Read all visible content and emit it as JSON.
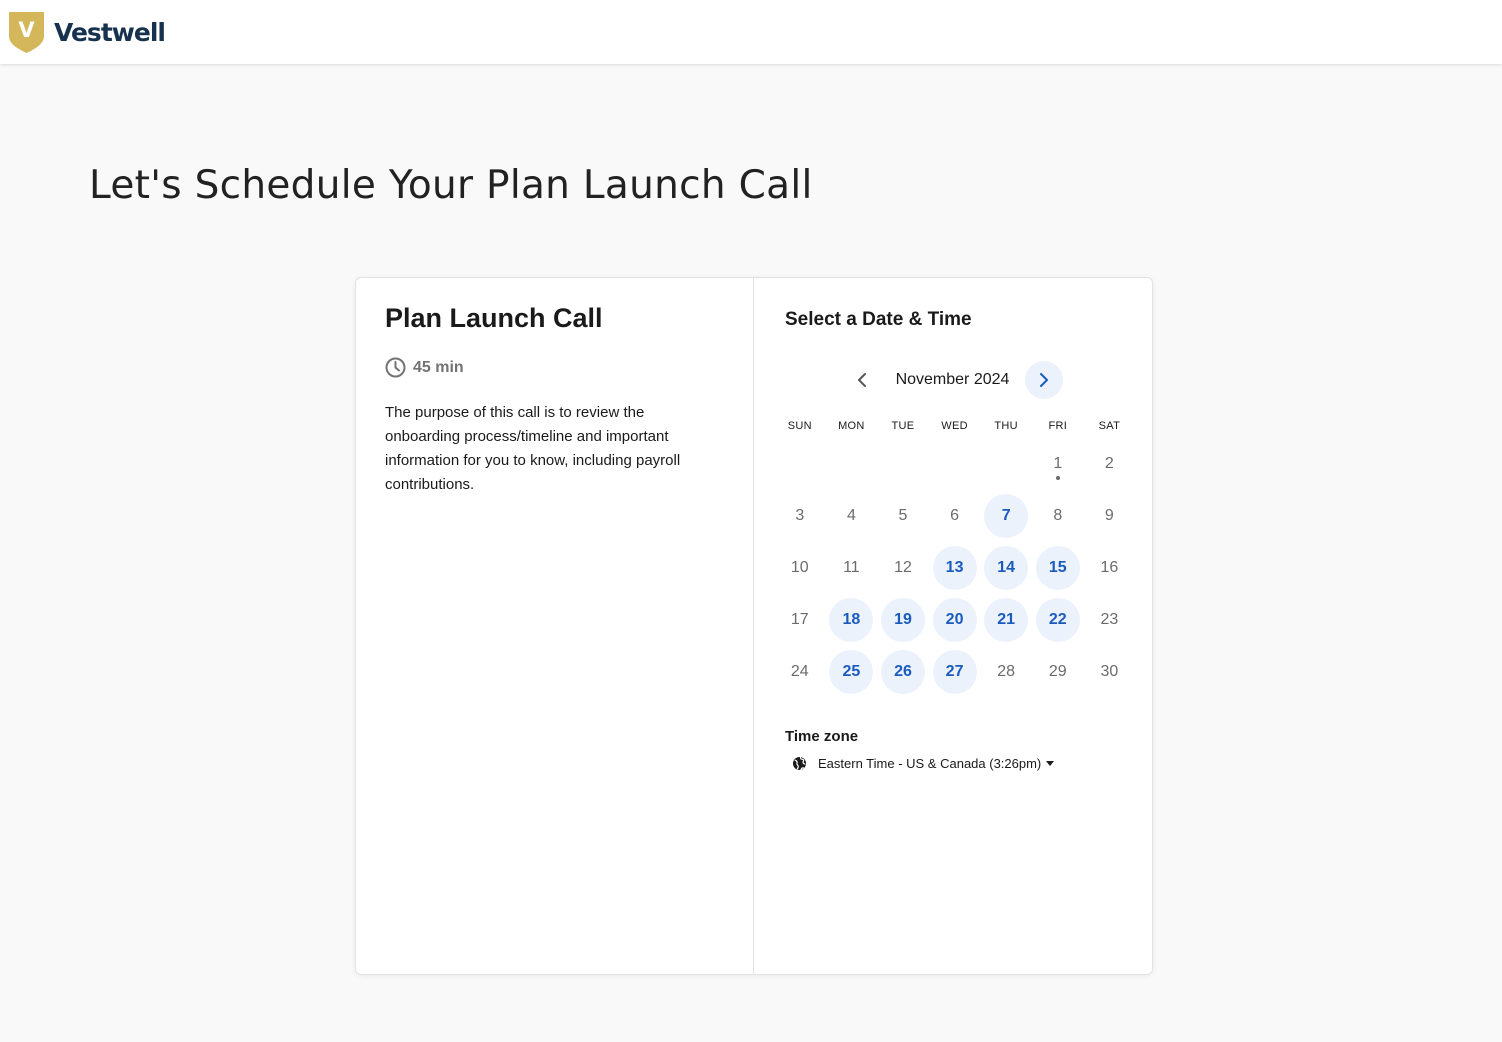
{
  "header": {
    "logo_letter": "V",
    "logo_text": "Vestwell",
    "logo_color": "#d4b75a",
    "brand_color": "#16324f"
  },
  "page": {
    "title": "Let's Schedule Your Plan Launch Call"
  },
  "event": {
    "title": "Plan Launch Call",
    "duration": "45 min",
    "description": "The purpose of this call is to review the onboarding process/timeline and important information for you to know, including payroll contributions."
  },
  "scheduler": {
    "title": "Select a Date & Time",
    "month": "November 2024",
    "prev_icon": "chevron-left-icon",
    "next_icon": "chevron-right-icon",
    "weekdays": [
      "SUN",
      "MON",
      "TUE",
      "WED",
      "THU",
      "FRI",
      "SAT"
    ],
    "days": [
      {
        "label": "",
        "available": false
      },
      {
        "label": "",
        "available": false
      },
      {
        "label": "",
        "available": false
      },
      {
        "label": "",
        "available": false
      },
      {
        "label": "",
        "available": false
      },
      {
        "label": "1",
        "available": false,
        "today": true
      },
      {
        "label": "2",
        "available": false
      },
      {
        "label": "3",
        "available": false
      },
      {
        "label": "4",
        "available": false
      },
      {
        "label": "5",
        "available": false
      },
      {
        "label": "6",
        "available": false
      },
      {
        "label": "7",
        "available": true
      },
      {
        "label": "8",
        "available": false
      },
      {
        "label": "9",
        "available": false
      },
      {
        "label": "10",
        "available": false
      },
      {
        "label": "11",
        "available": false
      },
      {
        "label": "12",
        "available": false
      },
      {
        "label": "13",
        "available": true
      },
      {
        "label": "14",
        "available": true
      },
      {
        "label": "15",
        "available": true
      },
      {
        "label": "16",
        "available": false
      },
      {
        "label": "17",
        "available": false
      },
      {
        "label": "18",
        "available": true
      },
      {
        "label": "19",
        "available": true
      },
      {
        "label": "20",
        "available": true
      },
      {
        "label": "21",
        "available": true
      },
      {
        "label": "22",
        "available": true
      },
      {
        "label": "23",
        "available": false
      },
      {
        "label": "24",
        "available": false
      },
      {
        "label": "25",
        "available": true
      },
      {
        "label": "26",
        "available": true
      },
      {
        "label": "27",
        "available": true
      },
      {
        "label": "28",
        "available": false
      },
      {
        "label": "29",
        "available": false
      },
      {
        "label": "30",
        "available": false
      }
    ],
    "available_bg": "#ebf2fc",
    "available_text": "#1a5bbd",
    "timezone_label": "Time zone",
    "timezone_value": "Eastern Time - US & Canada (3:26pm)",
    "timezone_icon": "globe-icon"
  }
}
